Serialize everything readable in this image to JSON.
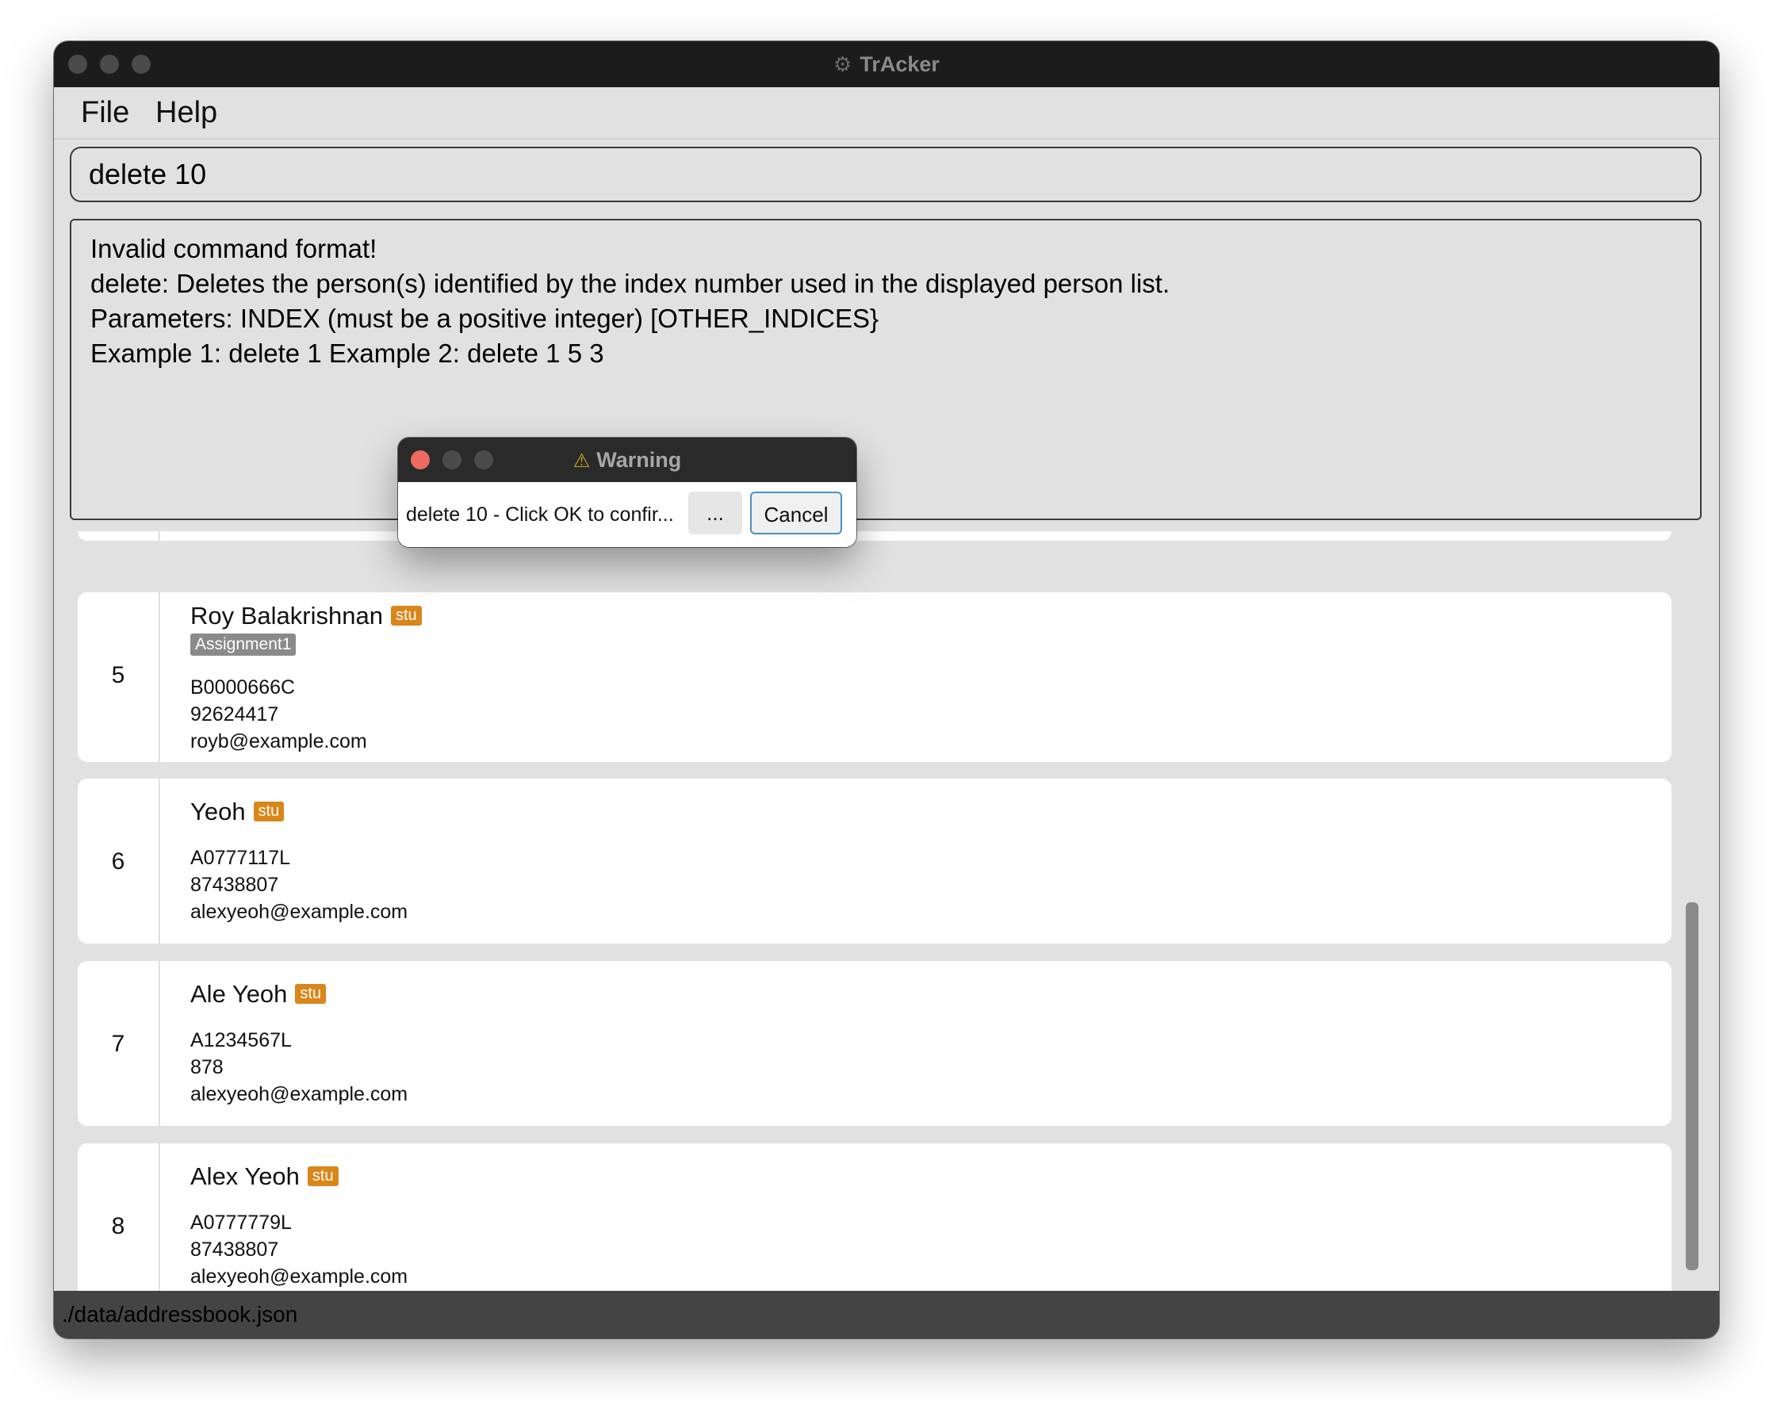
{
  "window": {
    "title": "TrAcker",
    "app_icon": "gear-bug-icon"
  },
  "menu": {
    "file": "File",
    "help": "Help"
  },
  "command": {
    "value": "delete 10"
  },
  "result": {
    "lines": [
      "Invalid command format!",
      "delete: Deletes the person(s) identified by the index number used in the displayed person list.",
      "Parameters: INDEX (must be a positive integer) [OTHER_INDICES}",
      "Example 1: delete 1 Example 2: delete 1 5 3"
    ]
  },
  "persons": [
    {
      "index": "5",
      "name": "Roy Balakrishnan",
      "tag": "stu",
      "assignment": "Assignment1",
      "id": "B0000666C",
      "phone": "92624417",
      "email": "royb@example.com"
    },
    {
      "index": "6",
      "name": "Yeoh",
      "tag": "stu",
      "id": "A0777117L",
      "phone": "87438807",
      "email": "alexyeoh@example.com"
    },
    {
      "index": "7",
      "name": "Ale Yeoh",
      "tag": "stu",
      "id": "A1234567L",
      "phone": "878",
      "email": "alexyeoh@example.com"
    },
    {
      "index": "8",
      "name": "Alex Yeoh",
      "tag": "stu",
      "id": "A0777779L",
      "phone": "87438807",
      "email": "alexyeoh@example.com"
    }
  ],
  "status": {
    "path": "./data/addressbook.json"
  },
  "dialog": {
    "title": "Warning",
    "warning_icon": "warning-triangle-icon",
    "message": "delete 10 - Click OK to confir...",
    "more_label": "...",
    "cancel_label": "Cancel"
  },
  "colors": {
    "tag_stu": "#d9861a",
    "tag_assignment": "#8a8a8a",
    "titlebar": "#1c1c1c",
    "statusbar": "#444444",
    "close_red": "#ec6a5e"
  }
}
